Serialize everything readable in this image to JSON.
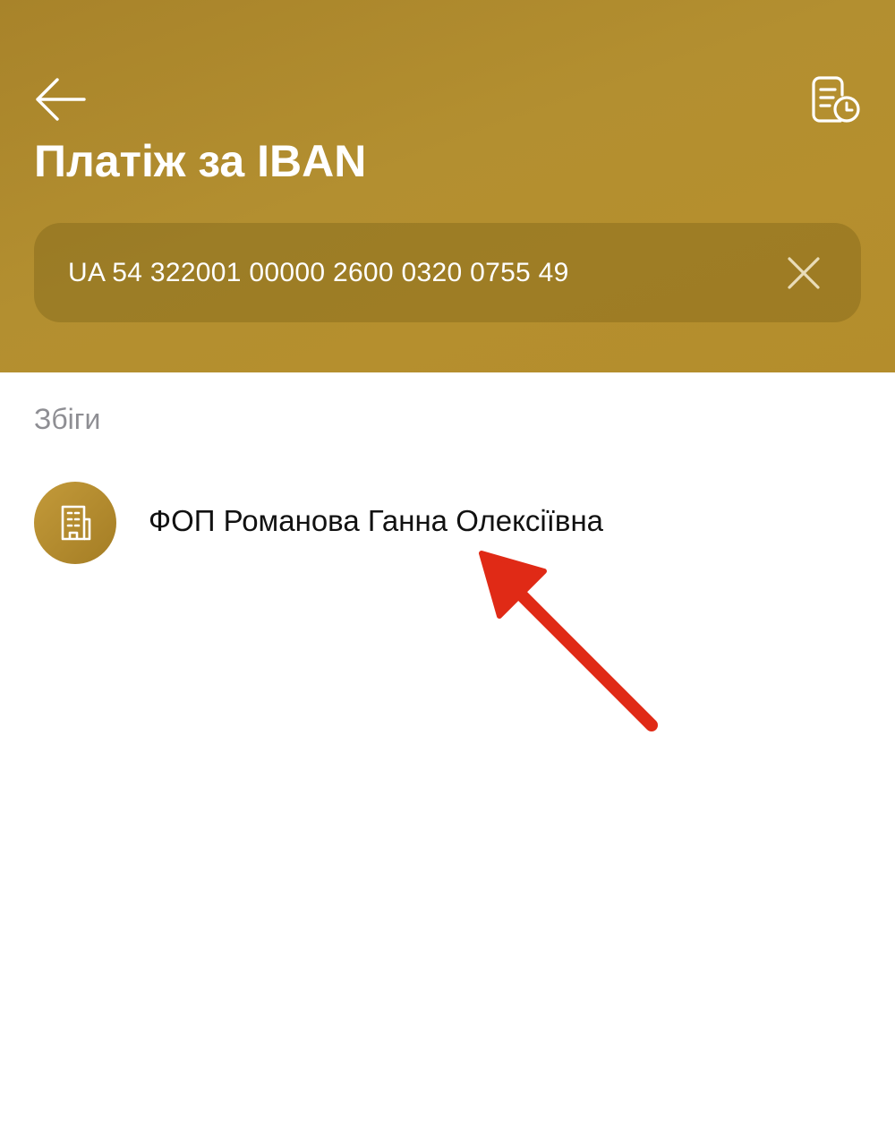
{
  "header": {
    "back_icon": "arrow-left-icon",
    "history_icon": "document-history-icon",
    "title": "Платіж за IBAN",
    "background_color": "#b08a2e"
  },
  "search": {
    "value": "UA 54 322001 00000 2600 0320 0755 49",
    "clear_icon": "close-icon"
  },
  "results": {
    "section_label": "Збіги",
    "items": [
      {
        "name": "ФОП Романова Ганна Олексіївна",
        "icon": "building-icon"
      }
    ]
  },
  "annotation": {
    "arrow_color": "#e02a16"
  }
}
